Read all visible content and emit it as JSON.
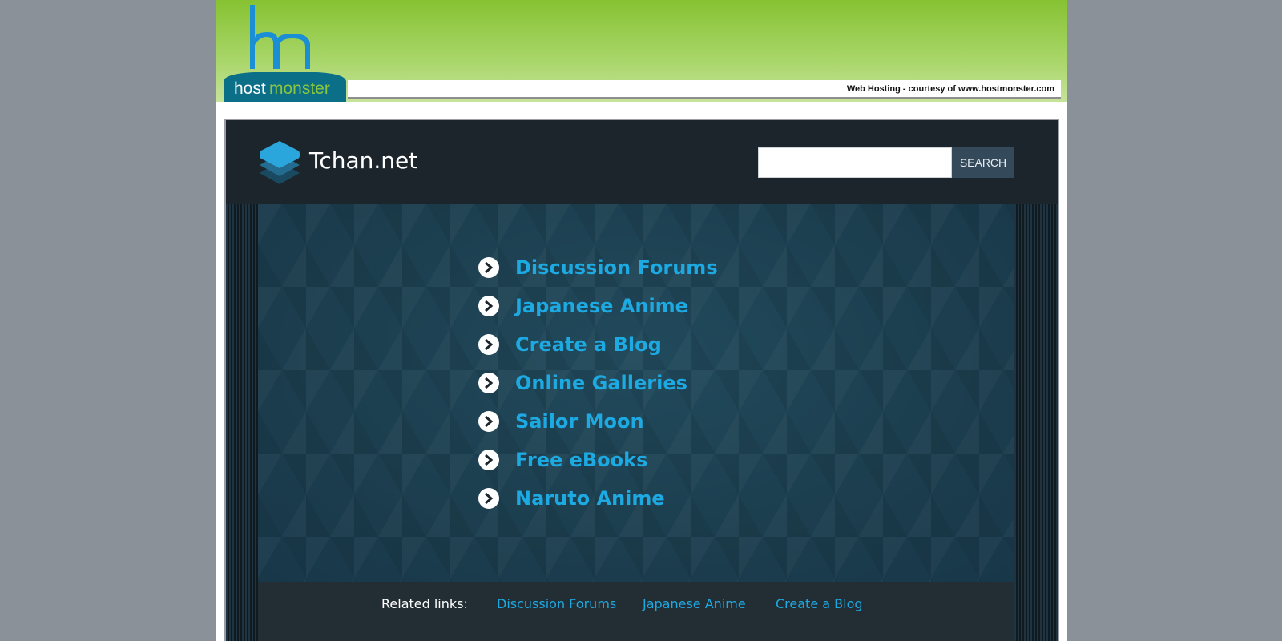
{
  "banner": {
    "logo_text_host": "host",
    "logo_text_monster": "monster",
    "courtesy_text": "Web Hosting - courtesy of www.hostmonster.com",
    "colors": {
      "green_top": "#86c232",
      "green_bottom": "#c6e39a",
      "logo_blue": "#1b8fd6",
      "logo_teal": "#0b6f87"
    }
  },
  "site": {
    "name": "Tchan.net",
    "logo_icon": "stacked-layers-icon"
  },
  "search": {
    "value": "",
    "placeholder": "",
    "button_label": "SEARCH"
  },
  "main_links": {
    "icon": "chevron-right-circle-icon",
    "items": [
      {
        "label": "Discussion Forums"
      },
      {
        "label": "Japanese Anime"
      },
      {
        "label": "Create a Blog"
      },
      {
        "label": "Online Galleries"
      },
      {
        "label": "Sailor Moon"
      },
      {
        "label": "Free eBooks"
      },
      {
        "label": "Naruto Anime"
      }
    ]
  },
  "related": {
    "title": "Related links:",
    "items": [
      {
        "label": "Discussion Forums"
      },
      {
        "label": "Japanese Anime"
      },
      {
        "label": "Create a Blog"
      }
    ]
  },
  "colors": {
    "page_background": "#8a9199",
    "header_dark": "#1c252c",
    "content_teal": "#1d4152",
    "link_blue": "#1da9e1",
    "search_button": "#34495a"
  }
}
